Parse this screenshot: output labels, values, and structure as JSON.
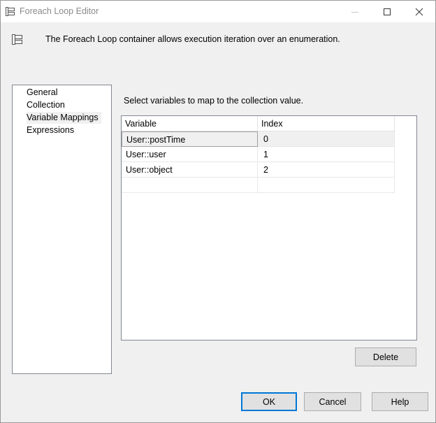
{
  "window": {
    "title": "Foreach Loop Editor",
    "title_icon": "foreach-loop-icon"
  },
  "header": {
    "description": "The Foreach Loop container allows execution iteration over an enumeration.",
    "icon": "foreach-loop-icon"
  },
  "nav": {
    "items": [
      {
        "label": "General",
        "selected": false
      },
      {
        "label": "Collection",
        "selected": false
      },
      {
        "label": "Variable Mappings",
        "selected": true
      },
      {
        "label": "Expressions",
        "selected": false
      }
    ]
  },
  "mappings": {
    "instruction": "Select variables to map to the collection value.",
    "columns": [
      "Variable",
      "Index"
    ],
    "rows": [
      {
        "variable": "User::postTime",
        "index": "0"
      },
      {
        "variable": "User::user",
        "index": "1"
      },
      {
        "variable": "User::object",
        "index": "2"
      },
      {
        "variable": "",
        "index": ""
      }
    ],
    "selected_row": 0
  },
  "buttons": {
    "delete": "Delete",
    "ok": "OK",
    "cancel": "Cancel",
    "help": "Help"
  },
  "colors": {
    "accent": "#0078d7",
    "dialog_bg": "#f0f0f0"
  }
}
